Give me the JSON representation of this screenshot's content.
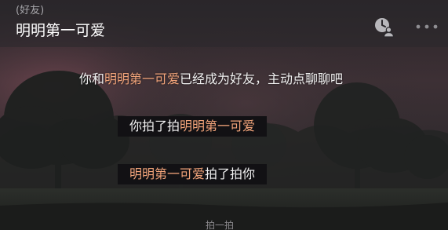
{
  "header": {
    "tag": "(好友)",
    "title": "明明第一可爱",
    "profile_icon": "person-clock-icon",
    "more_icon": "more-dots-icon"
  },
  "messages": {
    "system": {
      "before": "你和",
      "name": "明明第一可爱",
      "after": "已经成为好友，主动点聊聊吧"
    },
    "pat_1": {
      "actor": "你拍了拍",
      "target": "明明第一可爱"
    },
    "pat_2": {
      "actor": "明明第一可爱",
      "action": "拍了拍你"
    }
  },
  "footer": {
    "hint": "拍一拍"
  },
  "colors": {
    "nickname": "#f2a47a",
    "pat_bar_bg": "#121114",
    "header_bg": "#2a282c"
  }
}
